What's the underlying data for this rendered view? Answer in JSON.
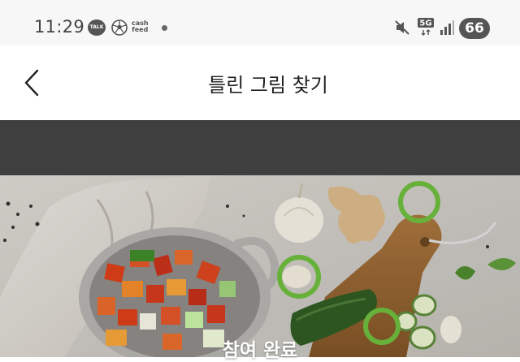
{
  "status_bar": {
    "time": "11:29",
    "talk_badge": "TALK",
    "cash_feed_line1": "cash",
    "cash_feed_line2": "feed",
    "network_label": "5G",
    "battery_level": "66"
  },
  "header": {
    "title": "틀린 그림 찾기"
  },
  "game": {
    "completion_label": "참여 완료",
    "difference_markers": [
      {
        "label": "ginger"
      },
      {
        "label": "garlic-clove"
      },
      {
        "label": "zucchini-slice"
      }
    ]
  }
}
